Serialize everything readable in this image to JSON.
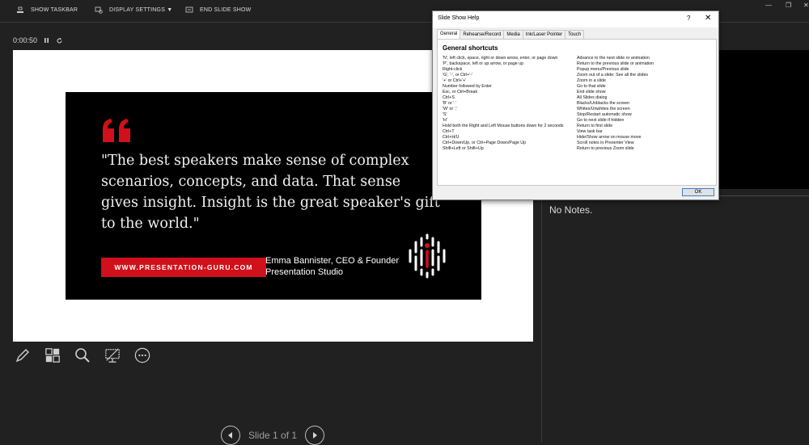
{
  "toolbar": {
    "show_taskbar": "SHOW TASKBAR",
    "display_settings": "DISPLAY SETTINGS ▼",
    "end_slide_show": "END SLIDE SHOW"
  },
  "timer": {
    "elapsed": "0:00:50"
  },
  "slide": {
    "quote": "\"The best speakers make sense of complex scenarios, concepts, and data. That sense gives insight. Insight is the great speaker's gift to the world.\"",
    "url": "WWW.PRESENTATION-GURU.COM",
    "author_line1": "Emma Bannister, CEO & Founder",
    "author_line2": "Presentation Studio"
  },
  "navigation": {
    "label": "Slide 1 of 1"
  },
  "notes": {
    "text": "No Notes."
  },
  "dialog": {
    "title": "Slide Show Help",
    "help_icon": "?",
    "close_icon": "✕",
    "tabs": [
      {
        "label": "General",
        "active": true
      },
      {
        "label": "Rehearse/Record",
        "active": false
      },
      {
        "label": "Media",
        "active": false
      },
      {
        "label": "Ink/Laser Pointer",
        "active": false
      },
      {
        "label": "Touch",
        "active": false
      }
    ],
    "heading": "General shortcuts",
    "shortcuts": [
      {
        "key": "'N', left click, space, right or down arrow, enter, or page down",
        "desc": "Advance to the next slide or animation"
      },
      {
        "key": "'P', backspace, left or up arrow, or page up",
        "desc": "Return to the previous slide or animation"
      },
      {
        "key": "Right-click",
        "desc": "Popup menu/Previous slide"
      },
      {
        "key": "'G', '-', or Ctrl+'-'",
        "desc": "Zoom out of a slide; See all the slides"
      },
      {
        "key": "'+' or Ctrl+'+'",
        "desc": "Zoom in a slide"
      },
      {
        "key": "Number followed by Enter",
        "desc": "Go to that slide"
      },
      {
        "key": "Esc, or Ctrl+Break",
        "desc": "End slide show"
      },
      {
        "key": "Ctrl+S",
        "desc": "All Slides dialog"
      },
      {
        "key": "'B' or '.'",
        "desc": "Blacks/Unblacks the screen"
      },
      {
        "key": "'W' or ','",
        "desc": "Whites/Unwhites the screen"
      },
      {
        "key": "'S'",
        "desc": "Stop/Restart automatic show"
      },
      {
        "key": "'H'",
        "desc": "Go to next slide if hidden"
      },
      {
        "key": "Hold both the Right and Left Mouse buttons down for 2 seconds",
        "desc": "Return to first slide"
      },
      {
        "key": "Ctrl+T",
        "desc": "View task bar"
      },
      {
        "key": "Ctrl+H/U",
        "desc": "Hide/Show arrow on mouse move"
      },
      {
        "key": "Ctrl+Down/Up, or Ctrl+Page Down/Page Up",
        "desc": "Scroll notes in Presenter View"
      },
      {
        "key": "Shift+Left or Shift+Up",
        "desc": "Return to previous Zoom slide"
      }
    ],
    "ok_label": "OK"
  },
  "colors": {
    "accent_red": "#d0101a",
    "background": "#212121"
  }
}
